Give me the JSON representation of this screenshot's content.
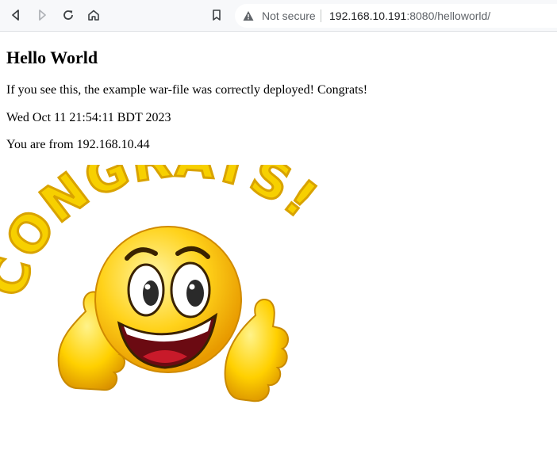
{
  "browser": {
    "security_label": "Not secure",
    "url_host": "192.168.10.191",
    "url_rest": ":8080/helloworld/",
    "icons": [
      "back-icon",
      "forward-icon",
      "reload-icon",
      "home-icon",
      "bookmark-icon",
      "warning-icon"
    ]
  },
  "page": {
    "title": "Hello World",
    "message": "If you see this, the example war-file was correctly deployed! Congrats!",
    "date": "Wed Oct 11 21:54:11 BDT 2023",
    "origin": "You are from 192.168.10.44"
  },
  "image": {
    "banner_text": "CONGRATS!",
    "colors": {
      "letters": "#f7d000",
      "letter_outline": "#d9a300",
      "face": "#ffd21a",
      "mouth": "#c81a2a"
    }
  }
}
